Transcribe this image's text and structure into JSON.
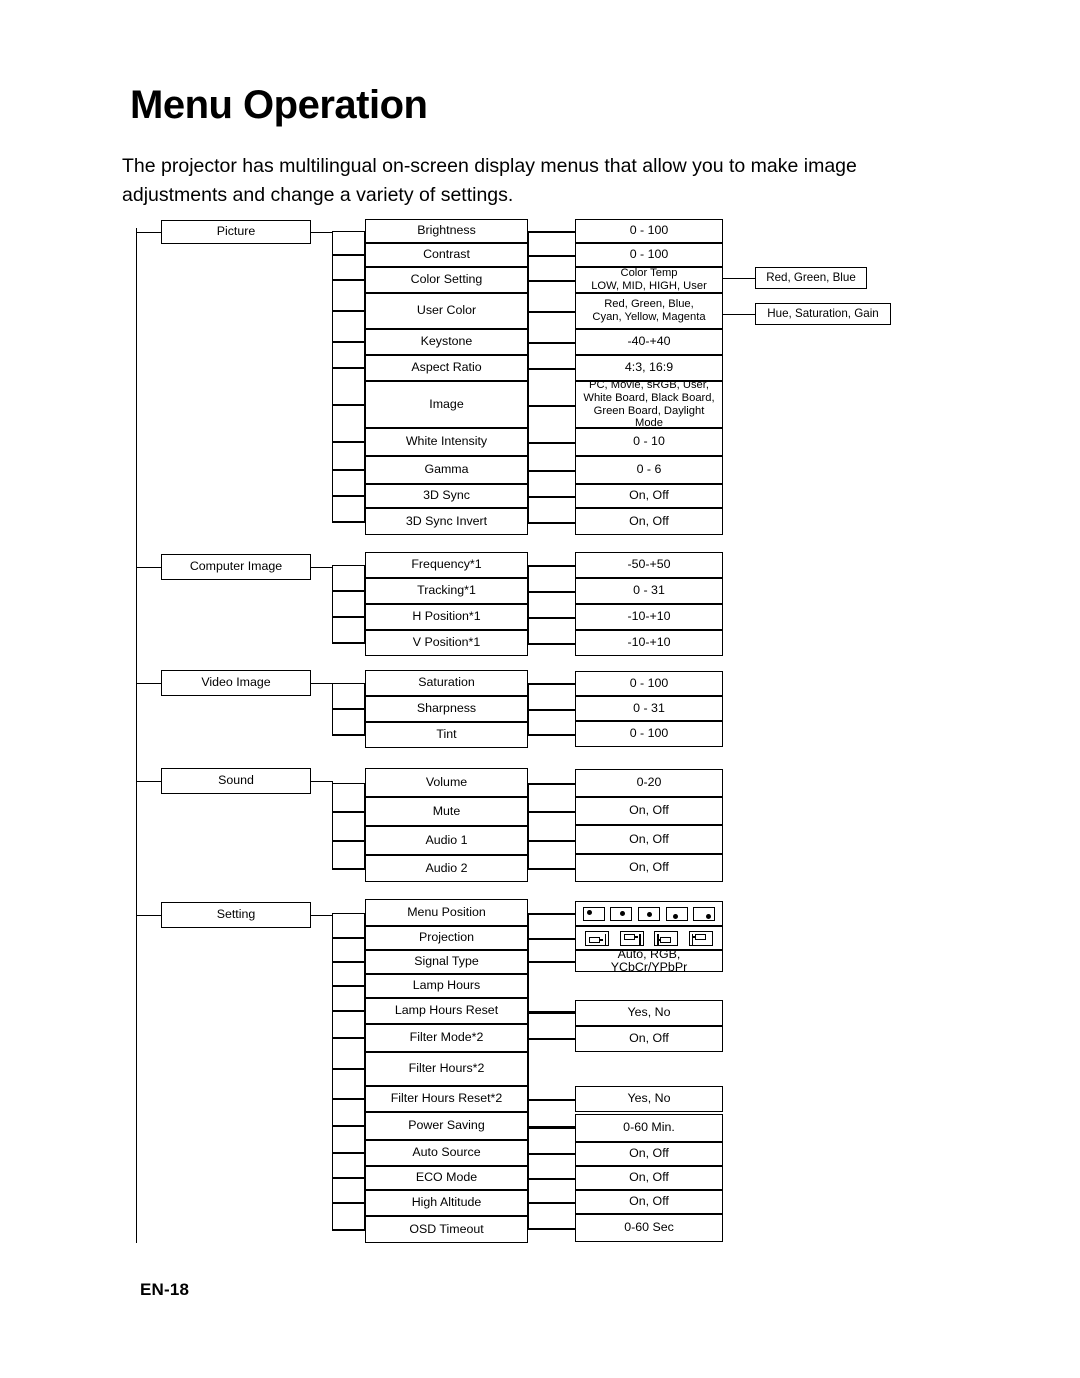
{
  "page": {
    "title": "Menu Operation",
    "intro_line1": "The projector has multilingual on-screen display menus that allow you to make image",
    "intro_line2": "adjustments and change a variety of settings.",
    "footer": "EN-18"
  },
  "menu_tree": [
    {
      "name": "Picture",
      "items": [
        {
          "label": "Brightness",
          "value": "0 - 100"
        },
        {
          "label": "Contrast",
          "value": "0 - 100"
        },
        {
          "label": "Color Setting",
          "value": "Color Temp\nLOW, MID, HIGH, User",
          "sub": "Red, Green, Blue"
        },
        {
          "label": "User Color",
          "value": "Red, Green, Blue,\nCyan, Yellow, Magenta",
          "sub": "Hue, Saturation, Gain"
        },
        {
          "label": "Keystone",
          "value": "-40-+40"
        },
        {
          "label": "Aspect Ratio",
          "value": "4:3, 16:9"
        },
        {
          "label": "Image",
          "value": "PC, Movie, sRGB, User,\nWhite Board, Black Board,\nGreen Board, Daylight Mode"
        },
        {
          "label": "White Intensity",
          "value": "0 - 10"
        },
        {
          "label": "Gamma",
          "value": "0 - 6"
        },
        {
          "label": "3D Sync",
          "value": "On, Off"
        },
        {
          "label": "3D Sync Invert",
          "value": "On, Off"
        }
      ]
    },
    {
      "name": "Computer Image",
      "items": [
        {
          "label": "Frequency*1",
          "value": "-50-+50"
        },
        {
          "label": "Tracking*1",
          "value": "0 - 31"
        },
        {
          "label": "H Position*1",
          "value": "-10-+10"
        },
        {
          "label": "V Position*1",
          "value": "-10-+10"
        }
      ]
    },
    {
      "name": "Video Image",
      "items": [
        {
          "label": "Saturation",
          "value": "0 - 100"
        },
        {
          "label": "Sharpness",
          "value": "0 - 31"
        },
        {
          "label": "Tint",
          "value": "0 - 100"
        }
      ]
    },
    {
      "name": "Sound",
      "items": [
        {
          "label": "Volume",
          "value": "0-20"
        },
        {
          "label": "Mute",
          "value": "On, Off"
        },
        {
          "label": "Audio 1",
          "value": "On, Off"
        },
        {
          "label": "Audio 2",
          "value": "On, Off"
        }
      ]
    },
    {
      "name": "Setting",
      "items": [
        {
          "label": "Menu Position",
          "value": "",
          "icons": "menu-position-icons"
        },
        {
          "label": "Projection",
          "value": "",
          "icons": "projection-icons"
        },
        {
          "label": "Signal Type",
          "value": "Auto, RGB, YCbCr/YPbPr"
        },
        {
          "label": "Lamp Hours",
          "value": ""
        },
        {
          "label": "Lamp Hours Reset",
          "value": "Yes, No"
        },
        {
          "label": "Filter Mode*2",
          "value": "On, Off"
        },
        {
          "label": "Filter Hours*2",
          "value": ""
        },
        {
          "label": "Filter Hours Reset*2",
          "value": "Yes, No"
        },
        {
          "label": "Power Saving",
          "value": "0-60 Min."
        },
        {
          "label": "Auto Source",
          "value": "On, Off"
        },
        {
          "label": "ECO Mode",
          "value": "On, Off"
        },
        {
          "label": "High Altitude",
          "value": "On, Off"
        },
        {
          "label": "OSD Timeout",
          "value": "0-60 Sec"
        }
      ]
    }
  ]
}
